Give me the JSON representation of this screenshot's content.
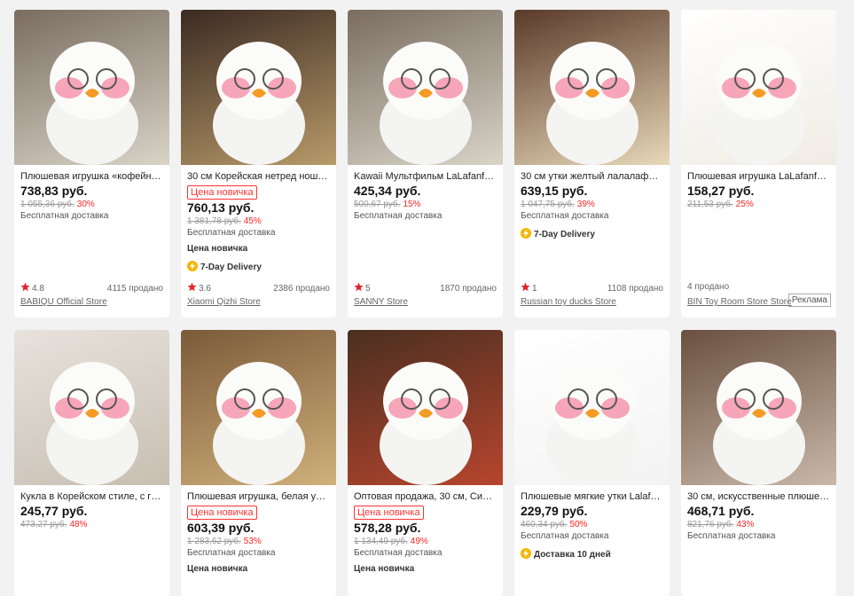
{
  "row1": [
    {
      "title": "Плюшевая игрушка «кофейная ж...",
      "price": "738,83 руб.",
      "old": "1 055,36 руб.",
      "disc": "30%",
      "ship": "Бесплатная доставка",
      "badge": "",
      "chip": "",
      "delivery": "",
      "rating": "4.8",
      "sold": "4115 продано",
      "store": "BABIQU Official Store",
      "ad": ""
    },
    {
      "title": "30 см Корейская нетред ношени...",
      "price": "760,13 руб.",
      "old": "1 381,78 руб.",
      "disc": "45%",
      "ship": "Бесплатная доставка",
      "badge": "Цена новичка",
      "chip": "Цена новичка",
      "delivery": "7-Day Delivery",
      "rating": "3.6",
      "sold": "2386 продано",
      "store": "Xiaomi Qizhi Store",
      "ad": ""
    },
    {
      "title": "Kawaii Мультфильм LaLafanfan 3...",
      "price": "425,34 руб.",
      "old": "500,67 руб.",
      "disc": "15%",
      "ship": "Бесплатная доставка",
      "badge": "",
      "chip": "",
      "delivery": "",
      "rating": "5",
      "sold": "1870 продано",
      "store": "SANNY Store",
      "ad": ""
    },
    {
      "title": "30 см утки желтый лалалафан Ка...",
      "price": "639,15 руб.",
      "old": "1 047,75 руб.",
      "disc": "39%",
      "ship": "Бесплатная доставка",
      "badge": "",
      "chip": "",
      "delivery": "7-Day Delivery",
      "rating": "1",
      "sold": "1108 продано",
      "store": "Russian toy ducks Store",
      "ad": ""
    },
    {
      "title": "Плюшевая игрушка LaLafanfan в ...",
      "price": "158,27 руб.",
      "old": "211,53 руб.",
      "disc": "25%",
      "ship": "",
      "badge": "",
      "chip": "",
      "delivery": "",
      "rating": "",
      "sold": "4 продано",
      "store": "BIN Toy Room Store Store",
      "ad": "Реклама"
    }
  ],
  "row2": [
    {
      "title": "Кукла в Корейском стиле, с гиалу...",
      "price": "245,77 руб.",
      "old": "473,27 руб.",
      "disc": "48%",
      "ship": "",
      "badge": "",
      "chip": "",
      "delivery": ""
    },
    {
      "title": "Плюшевая игрушка, белая утка л...",
      "price": "603,39 руб.",
      "old": "1 283,62 руб.",
      "disc": "53%",
      "ship": "Бесплатная доставка",
      "badge": "Цена новичка",
      "chip": "Цена новичка",
      "delivery": ""
    },
    {
      "title": "Оптовая продажа, 30 см, Симпат...",
      "price": "578,28 руб.",
      "old": "1 134,49 руб.",
      "disc": "49%",
      "ship": "Бесплатная доставка",
      "badge": "Цена новичка",
      "chip": "Цена новичка",
      "delivery": ""
    },
    {
      "title": "Плюшевые мягкие утки Lalafanfa...",
      "price": "229,79 руб.",
      "old": "460,34 руб.",
      "disc": "50%",
      "ship": "Бесплатная доставка",
      "badge": "",
      "chip": "",
      "delivery": "Доставка 10 дней"
    },
    {
      "title": "30 см, искусственные плюшевые...",
      "price": "468,71 руб.",
      "old": "821,76 руб.",
      "disc": "43%",
      "ship": "Бесплатная доставка",
      "badge": "",
      "chip": "",
      "delivery": ""
    }
  ],
  "icons": {
    "rating": "star-icon",
    "delivery": "lightning-truck-icon"
  }
}
